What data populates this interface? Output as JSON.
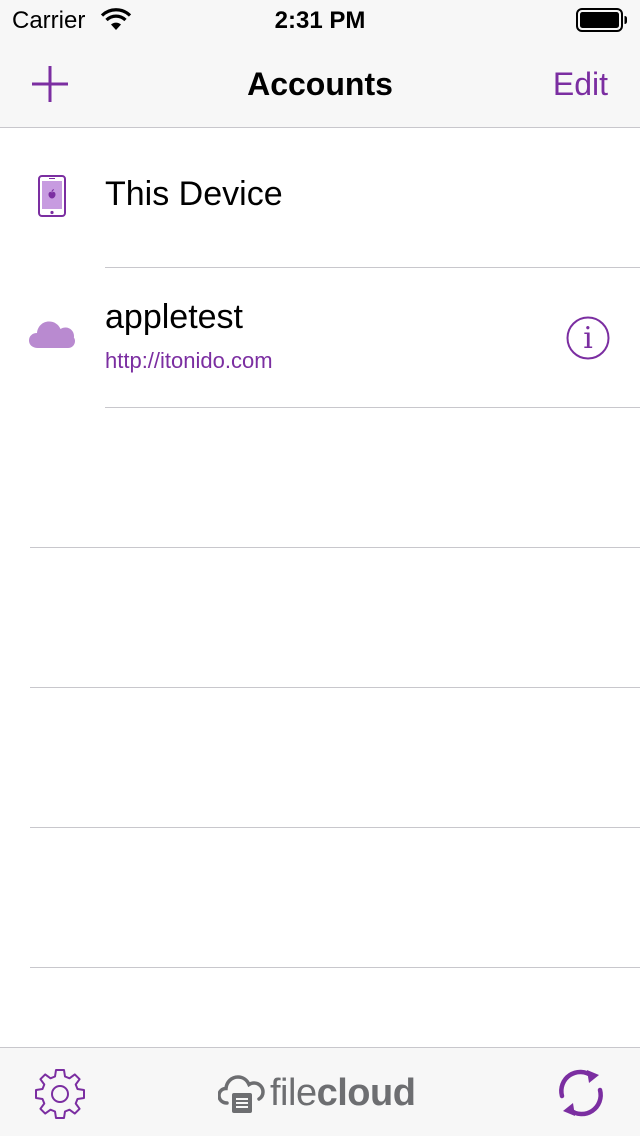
{
  "status_bar": {
    "carrier": "Carrier",
    "time": "2:31 PM",
    "wifi_icon": "wifi-icon",
    "battery_icon": "battery-icon"
  },
  "nav": {
    "title": "Accounts",
    "add_icon": "plus-icon",
    "edit_label": "Edit"
  },
  "accounts": {
    "device": {
      "label": "This Device",
      "icon": "phone-icon"
    },
    "items": [
      {
        "name": "appletest",
        "url": "http://itonido.com",
        "icon": "cloud-icon",
        "action_icon": "info-icon"
      }
    ]
  },
  "toolbar": {
    "settings_icon": "gear-icon",
    "logo": {
      "part1": "file",
      "part2": "cloud"
    },
    "sync_icon": "sync-icon"
  },
  "colors": {
    "accent": "#7b2ea1",
    "cloud_fill": "#b98ad0",
    "separator": "#c8c7cc",
    "bar_background": "#f7f7f7",
    "logo_gray": "#6d6e71"
  }
}
